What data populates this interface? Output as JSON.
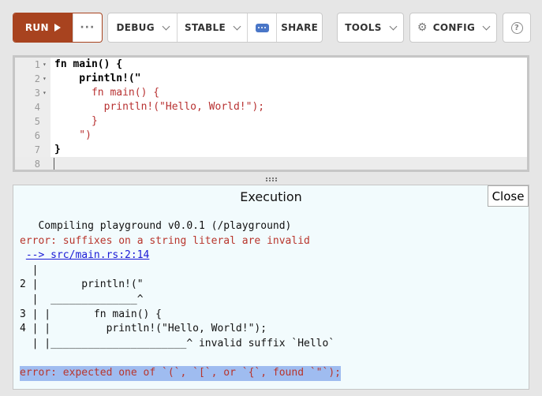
{
  "toolbar": {
    "run_label": "RUN",
    "more_label": "···",
    "debug_label": "DEBUG",
    "stable_label": "STABLE",
    "share_label": "SHARE",
    "tools_label": "TOOLS",
    "config_label": "CONFIG",
    "help_label": "?"
  },
  "editor": {
    "lines": [
      {
        "n": "1",
        "fold": "▾",
        "code": "fn main() {"
      },
      {
        "n": "2",
        "fold": "▾",
        "code": "    println!(\""
      },
      {
        "n": "3",
        "fold": "▾",
        "code": "      fn main() {"
      },
      {
        "n": "4",
        "fold": "",
        "code": "        println!(\"Hello, World!\");"
      },
      {
        "n": "5",
        "fold": "",
        "code": "      }"
      },
      {
        "n": "6",
        "fold": "",
        "code": "    \")"
      },
      {
        "n": "7",
        "fold": "",
        "code": "}"
      },
      {
        "n": "8",
        "fold": "",
        "code": ""
      }
    ]
  },
  "output": {
    "title": "Execution",
    "close_label": "Close",
    "lines": {
      "l0": "   Compiling playground v0.0.1 (/playground)",
      "l1": "error: suffixes on a string literal are invalid",
      "l2_arrow": " ",
      "l2_link": "--> src/main.rs:2:14",
      "l3": "  |",
      "l4": "2 |       println!(\"",
      "l5": "  |  ______________^",
      "l6": "3 | |       fn main() {",
      "l7": "4 | |         println!(\"Hello, World!\");",
      "l8": "  | |______________________^ invalid suffix `Hello`",
      "l10": "error: expected one of `(`, `[`, or `{`, found `\"`);"
    }
  },
  "colors": {
    "run": "#a8431f",
    "error": "#b8352c",
    "link": "#1a1ad6",
    "selection": "#9fbcf0"
  }
}
